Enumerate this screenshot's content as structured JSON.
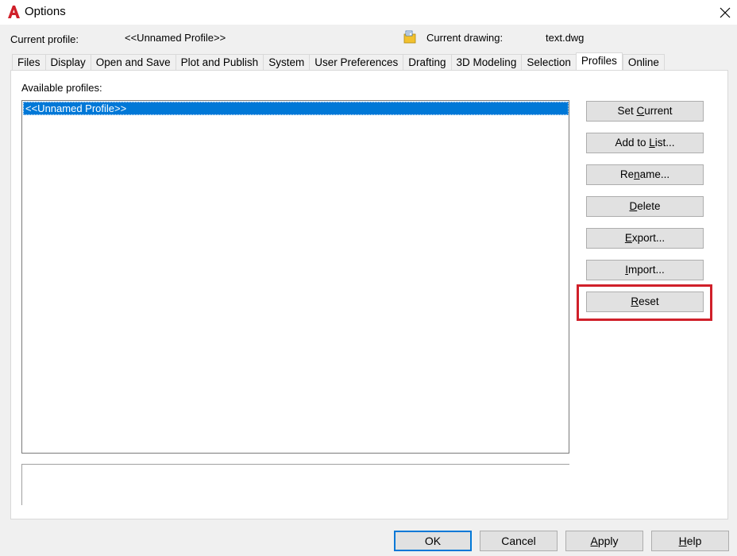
{
  "window": {
    "title": "Options"
  },
  "header": {
    "current_profile_label": "Current profile:",
    "current_profile_value": "<<Unnamed Profile>>",
    "current_drawing_label": "Current drawing:",
    "current_drawing_value": "text.dwg"
  },
  "tabs": [
    {
      "label": "Files"
    },
    {
      "label": "Display"
    },
    {
      "label": "Open and Save"
    },
    {
      "label": "Plot and Publish"
    },
    {
      "label": "System"
    },
    {
      "label": "User Preferences"
    },
    {
      "label": "Drafting"
    },
    {
      "label": "3D Modeling"
    },
    {
      "label": "Selection"
    },
    {
      "label": "Profiles",
      "active": true
    },
    {
      "label": "Online"
    }
  ],
  "profiles": {
    "label": "Available profiles:",
    "items": [
      {
        "label": "<<Unnamed Profile>>",
        "selected": true
      }
    ],
    "description": ""
  },
  "side_buttons": {
    "set_current": {
      "pre": "Set ",
      "u": "C",
      "post": "urrent"
    },
    "add_to_list": {
      "pre": "Add to ",
      "u": "L",
      "post": "ist..."
    },
    "rename": {
      "pre": "Re",
      "u": "n",
      "post": "ame..."
    },
    "delete": {
      "pre": "",
      "u": "D",
      "post": "elete"
    },
    "export": {
      "pre": "",
      "u": "E",
      "post": "xport..."
    },
    "import": {
      "pre": "",
      "u": "I",
      "post": "mport..."
    },
    "reset": {
      "pre": "",
      "u": "R",
      "post": "eset"
    }
  },
  "bottom_buttons": {
    "ok": "OK",
    "cancel": "Cancel",
    "apply": {
      "pre": "",
      "u": "A",
      "post": "pply"
    },
    "help": {
      "pre": "",
      "u": "H",
      "post": "elp"
    }
  },
  "colors": {
    "accent": "#0078d7",
    "highlight": "#d0202a",
    "app_icon": "#d0202a"
  }
}
